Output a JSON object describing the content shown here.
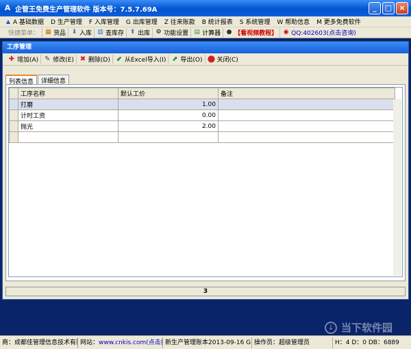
{
  "window": {
    "title": "企管王免费生产管理软件  版本号：7.5.7.69A",
    "min": "_",
    "max": "□",
    "close": "×"
  },
  "menu": [
    {
      "icon": "A",
      "label": "A 基础数据"
    },
    {
      "icon": "",
      "label": "D 生产管理"
    },
    {
      "icon": "",
      "label": "F 入库管理"
    },
    {
      "icon": "",
      "label": "G 出库管理"
    },
    {
      "icon": "",
      "label": "Z 往来账款"
    },
    {
      "icon": "",
      "label": "B 统计报表"
    },
    {
      "icon": "",
      "label": "S 系统管理"
    },
    {
      "icon": "",
      "label": "W 帮助信息"
    },
    {
      "icon": "",
      "label": "M 更多免费软件"
    }
  ],
  "quickbar": {
    "label": "快捷菜单：",
    "items": [
      {
        "label": "货品"
      },
      {
        "label": "入库"
      },
      {
        "label": "查库存"
      },
      {
        "label": "出库"
      },
      {
        "label": "功能设置"
      },
      {
        "label": "计算器"
      },
      {
        "label": "【看视频教程】"
      },
      {
        "label": "QQ:402603(点击咨询)"
      }
    ]
  },
  "child": {
    "title": "工序管理",
    "toolbar": [
      {
        "label": "增加(A)"
      },
      {
        "label": "修改(E)"
      },
      {
        "label": "删除(D)"
      },
      {
        "label": "从Excel导入(I)"
      },
      {
        "label": "导出(O)"
      },
      {
        "label": "关闭(C)"
      }
    ],
    "tabs": [
      {
        "label": "列表信息"
      },
      {
        "label": "详细信息"
      }
    ],
    "columns": [
      "工序名称",
      "默认工价",
      "备注"
    ],
    "rows": [
      {
        "name": "打磨",
        "price": "1.00",
        "note": ""
      },
      {
        "name": "计时工资",
        "price": "0.00",
        "note": ""
      },
      {
        "name": "抛光",
        "price": "2.00",
        "note": ""
      }
    ],
    "status_count": "3"
  },
  "statusbar": {
    "company": "商：成都佳管理信息技术有限",
    "site_label": "网站：",
    "site_url": "www.cnkis.com",
    "notice": "(点击打",
    "account": "新生产管理账本2013-09-16 G",
    "operator": "操作员：超级管理员",
    "db": "H：4 D：0 DB：6889"
  },
  "watermark": {
    "text": "当下软件园"
  }
}
